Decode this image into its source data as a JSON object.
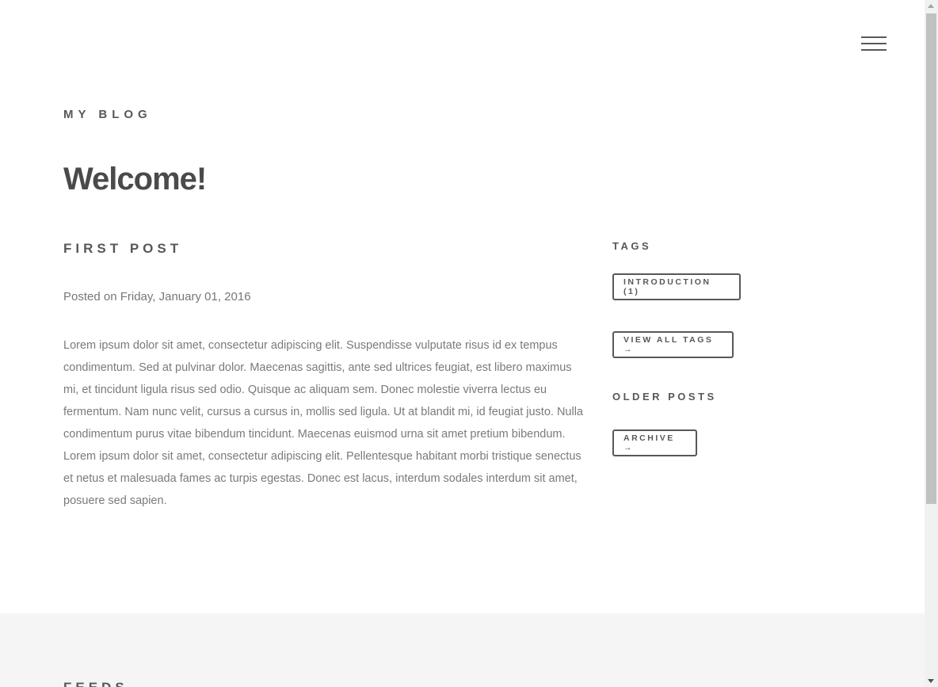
{
  "header": {
    "site_title": "MY BLOG",
    "menu_icon": "hamburger-menu-icon"
  },
  "main": {
    "heading": "Welcome!",
    "post": {
      "title": "FIRST POST",
      "meta": "Posted on Friday, January 01, 2016",
      "body": "Lorem ipsum dolor sit amet, consectetur adipiscing elit. Suspendisse vulputate risus id ex tempus condimentum. Sed at pulvinar dolor. Maecenas sagittis, ante sed ultrices feugiat, est libero maximus mi, et tincidunt ligula risus sed odio. Quisque ac aliquam sem. Donec molestie viverra lectus eu fermentum. Nam nunc velit, cursus a cursus in, mollis sed ligula. Ut at blandit mi, id feugiat justo. Nulla condimentum purus vitae bibendum tincidunt. Maecenas euismod urna sit amet pretium bibendum. Lorem ipsum dolor sit amet, consectetur adipiscing elit. Pellentesque habitant morbi tristique senectus et netus et malesuada fames ac turpis egestas. Donec est lacus, interdum sodales interdum sit amet, posuere sed sapien."
    }
  },
  "sidebar": {
    "tags_heading": "TAGS",
    "tag_button": "INTRODUCTION (1)",
    "view_all_tags": "VIEW ALL TAGS →",
    "older_posts_heading": "OLDER POSTS",
    "archive_button": "ARCHIVE →"
  },
  "footer": {
    "heading": "FEEDS"
  },
  "colors": {
    "text": "#585858",
    "body_text": "#7a7a7a",
    "footer_bg": "#f5f5f5"
  }
}
